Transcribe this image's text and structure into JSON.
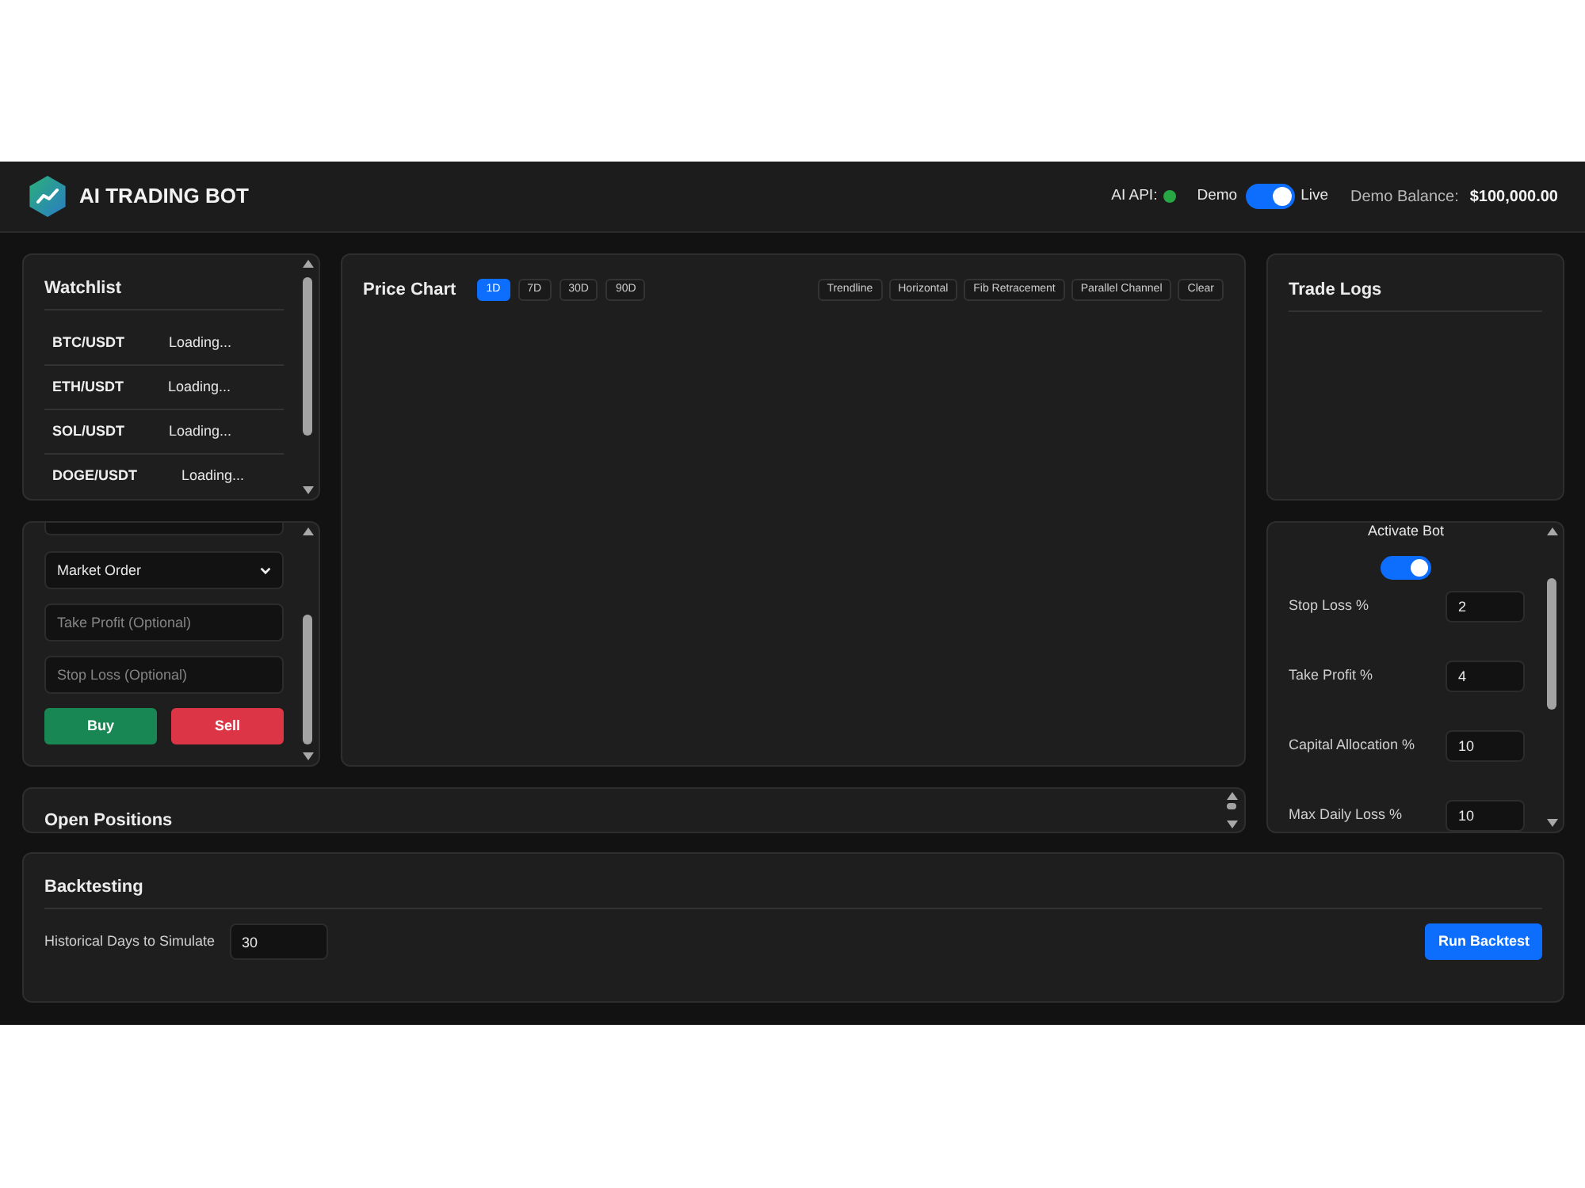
{
  "header": {
    "title": "AI TRADING BOT",
    "api_status": {
      "label": "AI API:",
      "connected": true
    },
    "mode_switch": {
      "left_label": "Demo",
      "right_label": "Live",
      "on": true
    },
    "balance": {
      "label": "Demo Balance:",
      "value": "$100,000.00"
    }
  },
  "watchlist": {
    "title": "Watchlist",
    "items": [
      {
        "symbol": "BTC/USDT",
        "price": "Loading..."
      },
      {
        "symbol": "ETH/USDT",
        "price": "Loading..."
      },
      {
        "symbol": "SOL/USDT",
        "price": "Loading..."
      },
      {
        "symbol": "DOGE/USDT",
        "price": "Loading..."
      }
    ]
  },
  "order_form": {
    "fields": [
      {
        "kind": "partial"
      },
      {
        "kind": "select",
        "value": "Market Order"
      },
      {
        "kind": "input",
        "placeholder": "Take Profit (Optional)"
      },
      {
        "kind": "input",
        "placeholder": "Stop Loss (Optional)"
      }
    ],
    "buttons": [
      {
        "kind": "buy",
        "label": "Buy"
      },
      {
        "kind": "sell",
        "label": "Sell"
      }
    ]
  },
  "price_chart": {
    "title": "Price Chart",
    "timeframes": [
      {
        "label": "1D",
        "selected": true
      },
      {
        "label": "7D",
        "selected": false
      },
      {
        "label": "30D",
        "selected": false
      },
      {
        "label": "90D",
        "selected": false
      }
    ],
    "tools": [
      "Trendline",
      "Horizontal",
      "Fib Retracement",
      "Parallel Channel",
      "Clear"
    ]
  },
  "trade_logs": {
    "title": "Trade Logs"
  },
  "bot_settings": {
    "activate_label": "Activate Bot",
    "active": true,
    "fields": [
      {
        "label": "Stop Loss %",
        "value": "2"
      },
      {
        "label": "Take Profit %",
        "value": "4"
      },
      {
        "label": "Capital Allocation %",
        "value": "10"
      },
      {
        "label": "Max Daily Loss %",
        "value": "10"
      }
    ]
  },
  "open_positions": {
    "title": "Open Positions"
  },
  "backtesting": {
    "title": "Backtesting",
    "field_label": "Historical Days to Simulate",
    "field_value": "30",
    "button": "Run Backtest"
  }
}
